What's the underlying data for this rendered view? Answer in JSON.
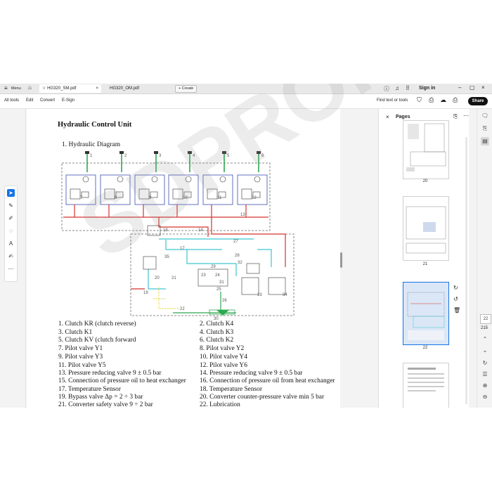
{
  "tabbar": {
    "menu_label": "Menu",
    "tab_active_label": "HG320_SM.pdf",
    "tab_second_label": "HG320_OM.pdf",
    "create_label": "+ Create",
    "sign_in_label": "Sign in"
  },
  "menubar": {
    "items": [
      "All tools",
      "Edit",
      "Convert",
      "E-Sign"
    ],
    "find_label": "Find text or tools",
    "share_label": "Share"
  },
  "document": {
    "heading": "Hydraulic Control  Unit",
    "subheading": "1. Hydraulic Diagram",
    "diagram_numbers": [
      "1",
      "2",
      "3",
      "4",
      "5",
      "6",
      "7",
      "8",
      "9",
      "10",
      "11",
      "12",
      "13",
      "14",
      "18",
      "17",
      "21",
      "20",
      "19",
      "22",
      "23",
      "24",
      "25",
      "26",
      "27",
      "28",
      "29",
      "30",
      "31",
      "32",
      "33",
      "34",
      "35"
    ],
    "legend_left": [
      "1.  Clutch KR (clutch reverse)",
      "3.  Clutch K1",
      "5.  Clutch KV (clutch forward",
      "7.  Pilot valve Y1",
      "9.  Pilot valve Y3",
      "11. Pilot valve Y5",
      "13. Pressure reducing valve 9 ± 0.5 bar",
      "15. Connection of pressure oil to heat exchanger",
      "17. Temperature Sensor",
      "19. Bypass valve Δp = 2 ÷ 3 bar",
      "21. Converter safety valve 9 ÷ 2 bar"
    ],
    "legend_right": [
      "2. Clutch K4",
      "4. Clutch K3",
      "6. Clutch K2",
      "8. Pilot valve Y2",
      "10. Pilot valve Y4",
      "12. Pilot valve Y6",
      "14. Pressure reducing valve 9 ± 0.5 bar",
      "16. Connection of pressure oil from heat exchanger",
      "18. Temperature Sensor",
      "20. Converter counter-pressure valve min 5 bar",
      "22. Lubrication"
    ],
    "watermark": "SDPRO.COM"
  },
  "pages_panel": {
    "title": "Pages",
    "thumbnails": [
      {
        "number": "20"
      },
      {
        "number": "21"
      },
      {
        "number": "22",
        "selected": true
      }
    ]
  },
  "rightrail": {
    "current_page": "22",
    "total_pages": "215"
  },
  "colors": {
    "accent_blue": "#1473e6",
    "selected_thumb_bg": "#dbe7f6",
    "line_red": "#d4332e",
    "line_cyan": "#3ec6d0",
    "line_green": "#2fa84f",
    "line_blue": "#3a4fb0",
    "line_yellow": "#e8d84a"
  }
}
